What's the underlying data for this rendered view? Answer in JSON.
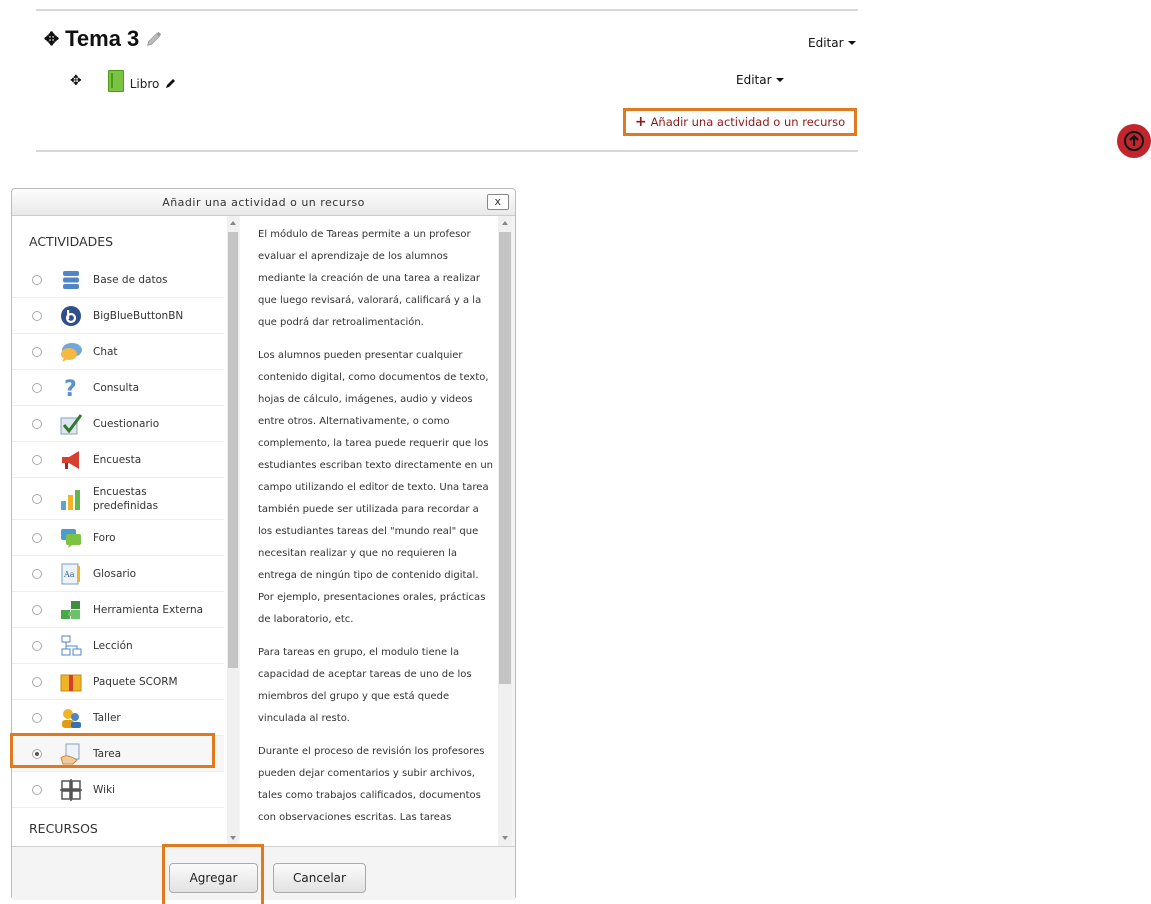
{
  "course": {
    "section_title": "Tema 3",
    "section_edit_label": "Editar",
    "activity_name": "Libro",
    "activity_edit_label": "Editar",
    "add_activity_label": "Añadir una actividad o un recurso"
  },
  "modal": {
    "title": "Añadir una actividad o un recurso",
    "close_label": "x",
    "activities_heading": "ACTIVIDADES",
    "resources_heading": "RECURSOS",
    "selected": "Tarea",
    "items": [
      {
        "label": "Base de datos",
        "icon": "database-icon"
      },
      {
        "label": "BigBlueButtonBN",
        "icon": "bigbluebutton-icon"
      },
      {
        "label": "Chat",
        "icon": "chat-icon"
      },
      {
        "label": "Consulta",
        "icon": "question-icon"
      },
      {
        "label": "Cuestionario",
        "icon": "quiz-icon"
      },
      {
        "label": "Encuesta",
        "icon": "megaphone-icon"
      },
      {
        "label": "Encuestas predefinidas",
        "icon": "bar-chart-icon"
      },
      {
        "label": "Foro",
        "icon": "forum-icon"
      },
      {
        "label": "Glosario",
        "icon": "glossary-icon"
      },
      {
        "label": "Herramienta Externa",
        "icon": "puzzle-icon"
      },
      {
        "label": "Lección",
        "icon": "lesson-icon"
      },
      {
        "label": "Paquete SCORM",
        "icon": "package-icon"
      },
      {
        "label": "Taller",
        "icon": "workshop-icon"
      },
      {
        "label": "Tarea",
        "icon": "assignment-icon"
      },
      {
        "label": "Wiki",
        "icon": "wiki-icon"
      }
    ],
    "description": [
      "El módulo de Tareas permite a un profesor evaluar el aprendizaje de los alumnos mediante la creación de una tarea a realizar que luego revisará, valorará, calificará y a la que podrá dar retroalimentación.",
      "Los alumnos pueden presentar cualquier contenido digital, como documentos de texto, hojas de cálculo, imágenes, audio y videos entre otros. Alternativamente, o como complemento, la tarea puede requerir que los estudiantes escriban texto directamente en un campo utilizando el editor de texto. Una tarea también puede ser utilizada para recordar a los estudiantes tareas del \"mundo real\" que necesitan realizar y que no requieren la entrega de ningún tipo de contenido digital. Por ejemplo, presentaciones orales, prácticas de laboratorio, etc.",
      "Para tareas en grupo, el modulo tiene la capacidad de aceptar tareas de uno de los miembros del grupo y que está quede vinculada al resto.",
      "Durante el proceso de revisión los profesores pueden dejar comentarios y subir archivos, tales como trabajos calificados, documentos con observaciones escritas. Las tareas"
    ],
    "add_button": "Agregar",
    "cancel_button": "Cancelar"
  },
  "colors": {
    "highlight": "#e07a1f",
    "link": "#8b1a1a",
    "scroll_top_button": "#c1262c"
  }
}
